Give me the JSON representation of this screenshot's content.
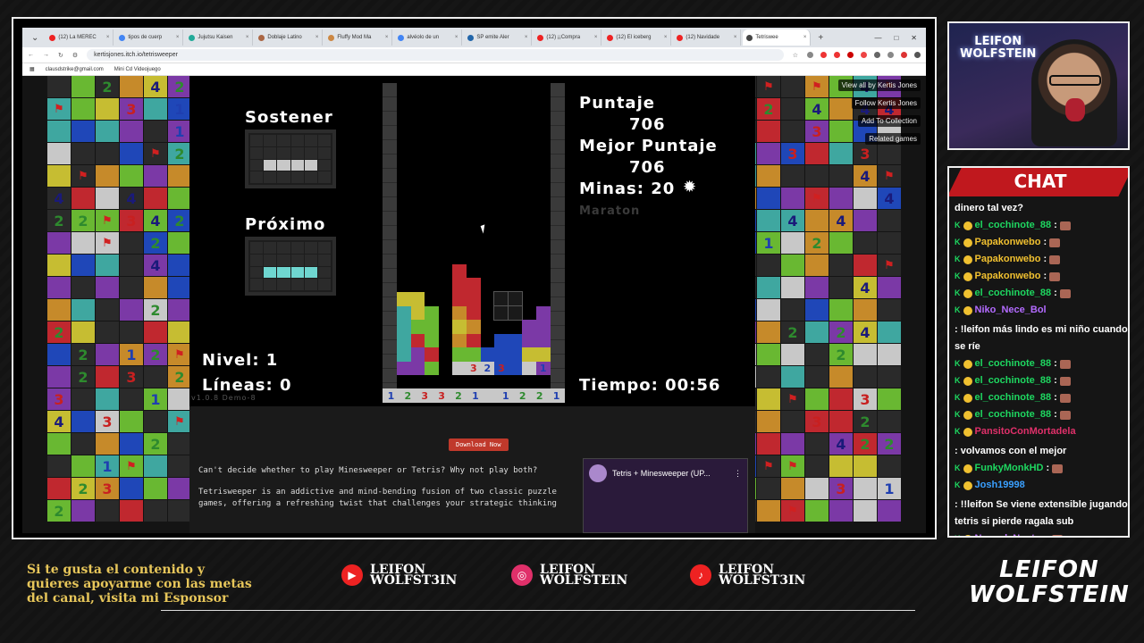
{
  "browser": {
    "tabs": [
      {
        "label": "(12) La MEREC",
        "color": "#e22"
      },
      {
        "label": "tipos de cuerp",
        "color": "#4285f4"
      },
      {
        "label": "Jujutsu Kaisen",
        "color": "#2a9"
      },
      {
        "label": "Doblaje Latino",
        "color": "#a64"
      },
      {
        "label": "Fluffy Mod Ma",
        "color": "#c84"
      },
      {
        "label": "alvéolo de un",
        "color": "#4285f4"
      },
      {
        "label": "SP emite Aler",
        "color": "#26a"
      },
      {
        "label": "(12) ¡¡Compra",
        "color": "#e22"
      },
      {
        "label": "(12) El iceberg",
        "color": "#e22"
      },
      {
        "label": "(12) Navidade",
        "color": "#e22"
      },
      {
        "label": "Tetriswee",
        "color": "#444"
      }
    ],
    "url": "kertisjones.itch.io/tetrisweeper",
    "bookmarks": [
      "clausdstrike@gmail.com",
      "Mini Cd Videojuego"
    ]
  },
  "game": {
    "hold_label": "Sostener",
    "next_label": "Próximo",
    "level_label": "Nivel: 1",
    "lines_label": "Líneas: 0",
    "version": "v1.0.8 Demo-8",
    "score_label": "Puntaje",
    "score": "706",
    "best_label": "Mejor Puntaje",
    "best": "706",
    "mines_label": "Minas: 20",
    "mode": "Maraton",
    "time_label": "Tiempo: 00:56",
    "floor_numbers": [
      "1",
      "2",
      "3",
      "3",
      "2",
      "1",
      "",
      "1",
      "2",
      "2",
      "1"
    ]
  },
  "itch": {
    "view_all": "View all by Kertis Jones",
    "follow": "Follow Kertis Jones",
    "collection": "Add To Collection",
    "related": "Related games"
  },
  "below": {
    "download": "Download Now",
    "line1": "Can't decide whether to play Minesweeper or Tetris? Why not play both?",
    "line2": "Tetrisweeper is an addictive and mind-bending fusion of two classic puzzle games, offering a refreshing twist that challenges your strategic thinking",
    "video_title": "Tetris + Minesweeper (UP..."
  },
  "cam": {
    "name_line1": "LEIFON",
    "name_line2": "WOLFSTEIN"
  },
  "chat": {
    "title": "CHAT",
    "messages": [
      {
        "user": "",
        "color": "#fff",
        "text": "dinero tal vez?"
      },
      {
        "user": "el_cochinote_88",
        "color": "#1ed760",
        "text": ":"
      },
      {
        "user": "Papakonwebo",
        "color": "#f0c030",
        "text": ":"
      },
      {
        "user": "Papakonwebo",
        "color": "#f0c030",
        "text": ":"
      },
      {
        "user": "Papakonwebo",
        "color": "#f0c030",
        "text": ":"
      },
      {
        "user": "el_cochinote_88",
        "color": "#1ed760",
        "text": ":"
      },
      {
        "user": "Niko_Nece_Bol",
        "color": "#b36bff",
        "text": ": !leifon más lindo es mi niño cuando se ríe"
      },
      {
        "user": "el_cochinote_88",
        "color": "#1ed760",
        "text": ":"
      },
      {
        "user": "el_cochinote_88",
        "color": "#1ed760",
        "text": ":"
      },
      {
        "user": "el_cochinote_88",
        "color": "#1ed760",
        "text": ":"
      },
      {
        "user": "el_cochinote_88",
        "color": "#1ed760",
        "text": ":"
      },
      {
        "user": "PansitoConMortadela",
        "color": "#e0306a",
        "text": ": volvamos con el mejor"
      },
      {
        "user": "FunkyMonkHD",
        "color": "#1ed760",
        "text": ":"
      },
      {
        "user": "Josh19998",
        "color": "#3aa0ff",
        "text": ": !!leifon Se viene extensible jugando tetris si pierde ragala sub"
      },
      {
        "user": "NosoylaNoctm",
        "color": "#c070ff",
        "text": ":"
      }
    ]
  },
  "footer": {
    "sponsor": "Si te gusta el contenido y quieres apoyarme con las metas del canal, visita mi Esponsor",
    "yt_top": "LEIFON",
    "yt_bottom": "WOLFST3IN",
    "ig_top": "LEIFON",
    "ig_bottom": "WOLFSTEIN",
    "tt_top": "LEIFON",
    "tt_bottom": "WOLFST3IN",
    "logo_top": "LEIFON",
    "logo_bottom": "WOLFSTEIN"
  }
}
